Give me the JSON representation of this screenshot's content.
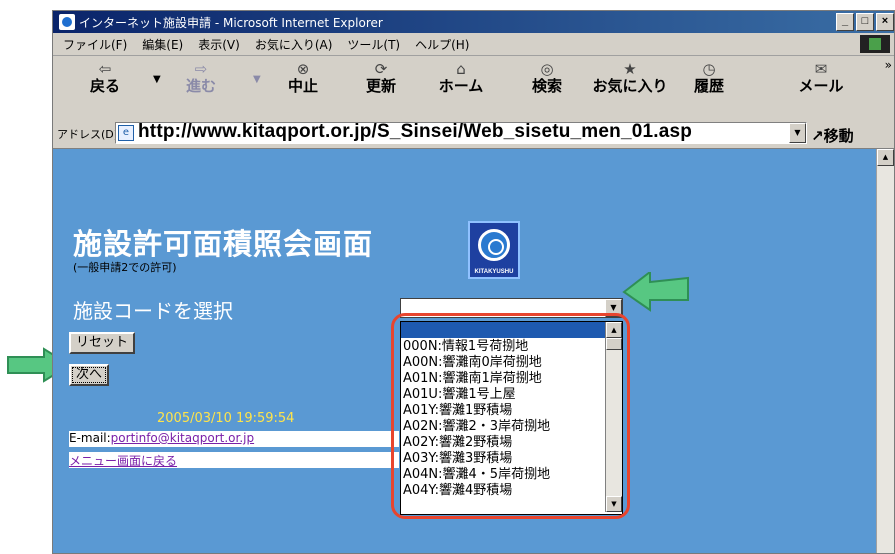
{
  "window": {
    "title": "インターネット施設申請 - Microsoft Internet Explorer",
    "controls": [
      "_",
      "□",
      "×"
    ]
  },
  "menu": [
    "ファイル(F)",
    "編集(E)",
    "表示(V)",
    "お気に入り(A)",
    "ツール(T)",
    "ヘルプ(H)"
  ],
  "toolbar": {
    "back": "戻る",
    "forward": "進む",
    "stop": "中止",
    "refresh": "更新",
    "home": "ホーム",
    "search": "検索",
    "favorites": "お気に入り",
    "history": "履歴",
    "mail": "メール"
  },
  "address": {
    "label": "アドレス(D)",
    "url": "http://www.kitaqport.or.jp/S_Sinsei/Web_sisetu_men_01.asp",
    "go": "移動"
  },
  "page": {
    "title": "施設許可面積照会画面",
    "subtitle": "(一般申請2での許可)",
    "logo_text": "KITAKYUSHU",
    "select_label": "施設コードを選択",
    "reset_button": "リセット",
    "next_button": "次へ",
    "timestamp": "2005/03/10 19:59:54",
    "email_label": "E-mail:",
    "email_link": "portinfo@kitaqport.or.jp",
    "menu_link": "メニュー画面に戻る"
  },
  "dropdown": {
    "selected": "",
    "options": [
      "000N:情報1号荷捌地",
      "A00N:響灘南0岸荷捌地",
      "A01N:響灘南1岸荷捌地",
      "A01U:響灘1号上屋",
      "A01Y:響灘1野積場",
      "A02N:響灘2・3岸荷捌地",
      "A02Y:響灘2野積場",
      "A03Y:響灘3野積場",
      "A04N:響灘4・5岸荷捌地",
      "A04Y:響灘4野積場"
    ]
  },
  "colors": {
    "page_background": "#5a99d3",
    "callout": "#e8452e",
    "arrow": "#3fb86a",
    "timestamp": "#ffe44a",
    "link": "#7a1fa8"
  }
}
